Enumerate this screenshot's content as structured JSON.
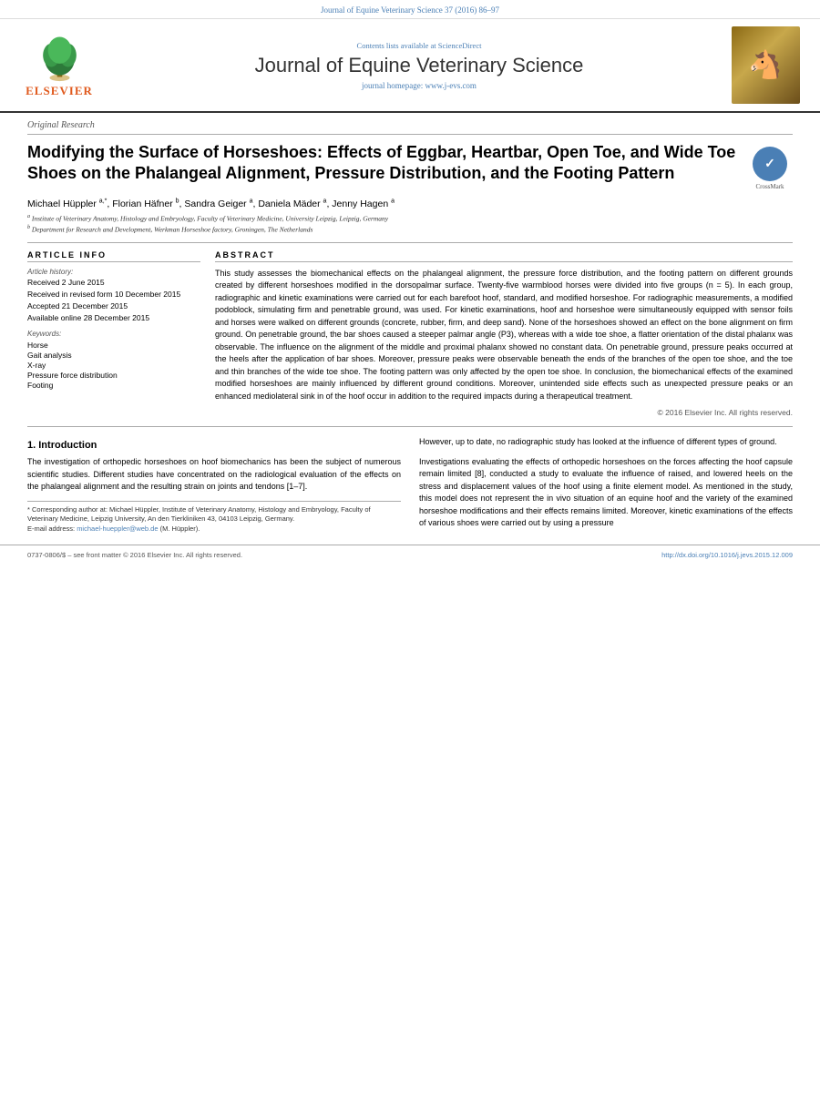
{
  "top_bar": {
    "text": "Journal of Equine Veterinary Science 37 (2016) 86–97"
  },
  "header": {
    "contents_prefix": "Contents lists available at ",
    "contents_link": "ScienceDirect",
    "journal_title": "Journal of Equine Veterinary Science",
    "homepage_prefix": "journal homepage: ",
    "homepage_link": "www.j-evs.com",
    "elsevier_brand": "ELSEVIER"
  },
  "article": {
    "category": "Original Research",
    "title": "Modifying the Surface of Horseshoes: Effects of Eggbar, Heartbar, Open Toe, and Wide Toe Shoes on the Phalangeal Alignment, Pressure Distribution, and the Footing Pattern",
    "crossmark_label": "CrossMark",
    "authors": "Michael Hüppler a,*, Florian Häfner b, Sandra Geiger a, Daniela Mäder a, Jenny Hagen a",
    "affiliations": [
      {
        "sup": "a",
        "text": "Institute of Veterinary Anatomy, Histology and Embryology, Faculty of Veterinary Medicine, University Leipzig, Leipzig, Germany"
      },
      {
        "sup": "b",
        "text": "Department for Research and Development, Werkman Horseshoe factory, Groningen, The Netherlands"
      }
    ],
    "article_info": {
      "heading": "ARTICLE INFO",
      "history_label": "Article history:",
      "history_items": [
        "Received 2 June 2015",
        "Received in revised form 10 December 2015",
        "Accepted 21 December 2015",
        "Available online 28 December 2015"
      ],
      "keywords_label": "Keywords:",
      "keywords": [
        "Horse",
        "Gait analysis",
        "X-ray",
        "Pressure force distribution",
        "Footing"
      ]
    },
    "abstract": {
      "heading": "ABSTRACT",
      "text": "This study assesses the biomechanical effects on the phalangeal alignment, the pressure force distribution, and the footing pattern on different grounds created by different horseshoes modified in the dorsopalmar surface. Twenty-five warmblood horses were divided into five groups (n = 5). In each group, radiographic and kinetic examinations were carried out for each barefoot hoof, standard, and modified horseshoe. For radiographic measurements, a modified podoblock, simulating firm and penetrable ground, was used. For kinetic examinations, hoof and horseshoe were simultaneously equipped with sensor foils and horses were walked on different grounds (concrete, rubber, firm, and deep sand). None of the horseshoes showed an effect on the bone alignment on firm ground. On penetrable ground, the bar shoes caused a steeper palmar angle (P3), whereas with a wide toe shoe, a flatter orientation of the distal phalanx was observable. The influence on the alignment of the middle and proximal phalanx showed no constant data. On penetrable ground, pressure peaks occurred at the heels after the application of bar shoes. Moreover, pressure peaks were observable beneath the ends of the branches of the open toe shoe, and the toe and thin branches of the wide toe shoe. The footing pattern was only affected by the open toe shoe. In conclusion, the biomechanical effects of the examined modified horseshoes are mainly influenced by different ground conditions. Moreover, unintended side effects such as unexpected pressure peaks or an enhanced mediolateral sink in of the hoof occur in addition to the required impacts during a therapeutical treatment.",
      "copyright": "© 2016 Elsevier Inc. All rights reserved."
    }
  },
  "body": {
    "section1": {
      "number": "1.",
      "title": "Introduction",
      "paragraphs": [
        "The investigation of orthopedic horseshoes on hoof biomechanics has been the subject of numerous scientific studies. Different studies have concentrated on the radiological evaluation of the effects on the phalangeal alignment and the resulting strain on joints and tendons [1–7].",
        "However, up to date, no radiographic study has looked at the influence of different types of ground.",
        "Investigations evaluating the effects of orthopedic horseshoes on the forces affecting the hoof capsule remain limited [8], conducted a study to evaluate the influence of raised, and lowered heels on the stress and displacement values of the hoof using a finite element model. As mentioned in the study, this model does not represent the in vivo situation of an equine hoof and the variety of the examined horseshoe modifications and their effects remains limited. Moreover, kinetic examinations of the effects of various shoes were carried out by using a pressure"
      ]
    }
  },
  "footnote": {
    "corresponding": "* Corresponding author at: Michael Hüppler, Institute of Veterinary Anatomy, Histology and Embryology, Faculty of Veterinary Medicine, Leipzig University, An den Tierkliniken 43, 04103 Leipzig, Germany.",
    "email_label": "E-mail address: ",
    "email": "michael-hueppler@web.de",
    "email_suffix": " (M. Hüppler)."
  },
  "footer": {
    "issn": "0737-0806/$ – see front matter © 2016 Elsevier Inc. All rights reserved.",
    "doi": "http://dx.doi.org/10.1016/j.jevs.2015.12.009"
  }
}
